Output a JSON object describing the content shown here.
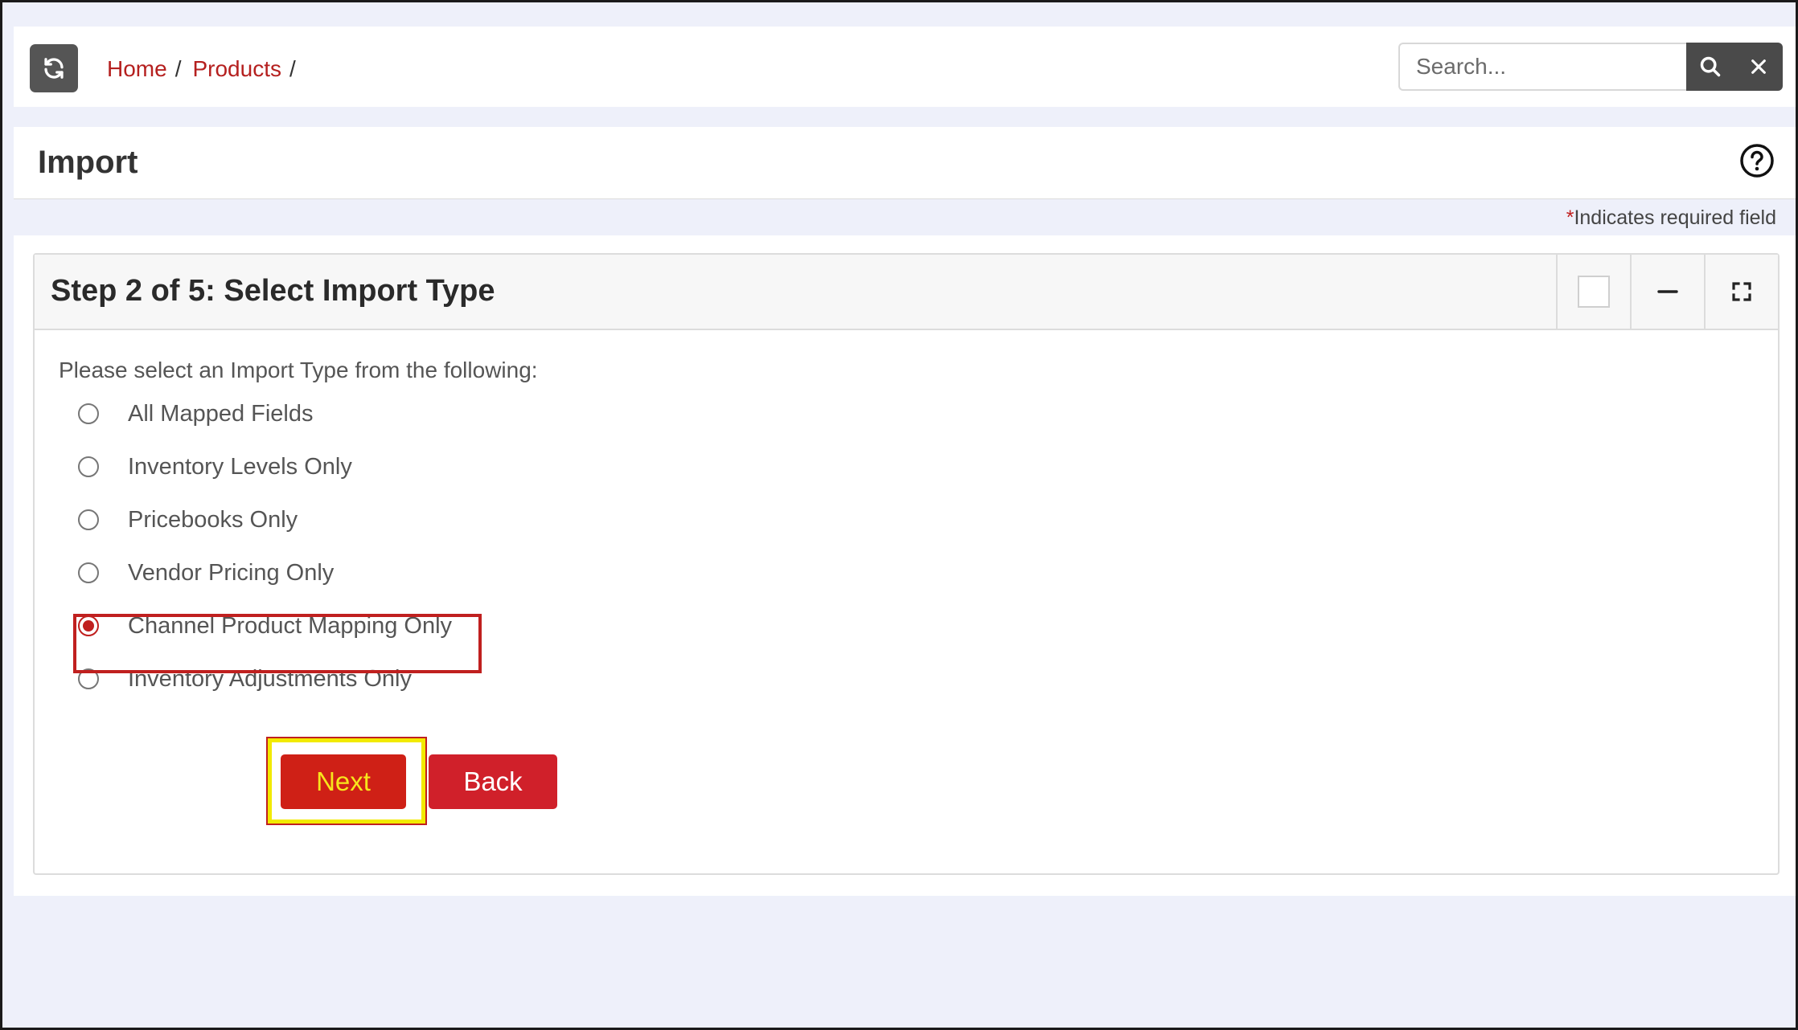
{
  "breadcrumb": {
    "items": [
      "Home",
      "Products"
    ],
    "separator": "/"
  },
  "search": {
    "placeholder": "Search..."
  },
  "page": {
    "title": "Import"
  },
  "required_note": {
    "star": "*",
    "text": "Indicates required field"
  },
  "panel": {
    "title": "Step 2 of 5: Select Import Type",
    "prompt": "Please select an Import Type from the following:",
    "options": [
      {
        "label": "All Mapped Fields",
        "checked": false
      },
      {
        "label": "Inventory Levels Only",
        "checked": false
      },
      {
        "label": "Pricebooks Only",
        "checked": false
      },
      {
        "label": "Vendor Pricing Only",
        "checked": false
      },
      {
        "label": "Channel Product Mapping Only",
        "checked": true
      },
      {
        "label": "Inventory Adjustments Only",
        "checked": false
      }
    ]
  },
  "buttons": {
    "next": "Next",
    "back": "Back"
  },
  "colors": {
    "accent": "#c0201f",
    "highlight": "#f2ea00",
    "dark_button": "#4a4a4a",
    "background": "#eef0fa"
  },
  "icons": {
    "refresh": "refresh-icon",
    "search": "search-icon",
    "clear": "close-icon",
    "help": "help-circle-icon",
    "minimize": "minus-icon",
    "fullscreen": "expand-icon"
  }
}
